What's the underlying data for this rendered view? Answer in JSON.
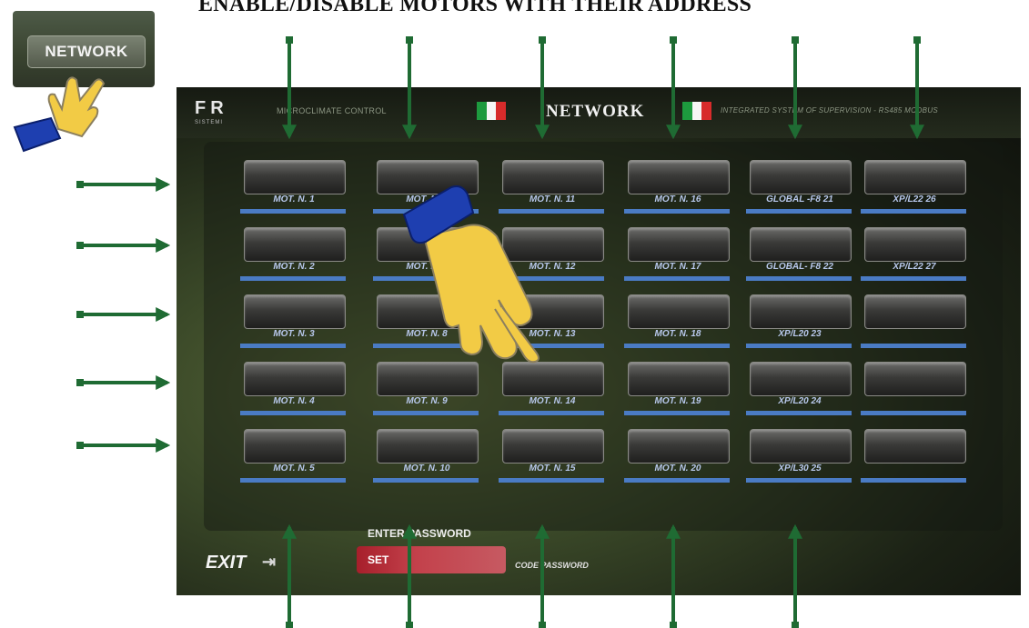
{
  "heading": "ENABLE/DISABLE MOTORS WITH THEIR ADDRESS",
  "network_button_label": "NETWORK",
  "topbar": {
    "logo": "FR",
    "logo_sub": "SISTEMI",
    "left_text": "MICROCLIMATE CONTROL",
    "title": "NETWORK",
    "right_text": "INTEGRATED SYSTEM OF SUPERVISION - RS485 MODBUS"
  },
  "motors": [
    [
      "MOT. N. 1",
      "MOT. N. 6",
      "MOT. N. 11",
      "MOT. N. 16",
      "GLOBAL -F8 21",
      "XP/L22 26"
    ],
    [
      "MOT. N. 2",
      "MOT. N. 7",
      "MOT. N. 12",
      "MOT. N. 17",
      "GLOBAL- F8 22",
      "XP/L22 27"
    ],
    [
      "MOT. N. 3",
      "MOT. N. 8",
      "MOT. N. 13",
      "MOT. N. 18",
      "XP/L20 23",
      ""
    ],
    [
      "MOT. N. 4",
      "MOT. N. 9",
      "MOT. N. 14",
      "MOT. N. 19",
      "XP/L20 24",
      ""
    ],
    [
      "MOT. N. 5",
      "MOT. N. 10",
      "MOT. N. 15",
      "MOT. N. 20",
      "XP/L30 25",
      ""
    ]
  ],
  "bottom": {
    "exit_label": "EXIT",
    "password_label": "ENTER PASSWORD",
    "set_label": "SET",
    "code_password": "CODE PASSWORD"
  },
  "colors": {
    "arrow": "#1f6b33",
    "label_bar": "#4a7bc4",
    "set_button": "#a71f2b",
    "hand_fill": "#f2cb45",
    "cuff": "#1e3fb0"
  }
}
